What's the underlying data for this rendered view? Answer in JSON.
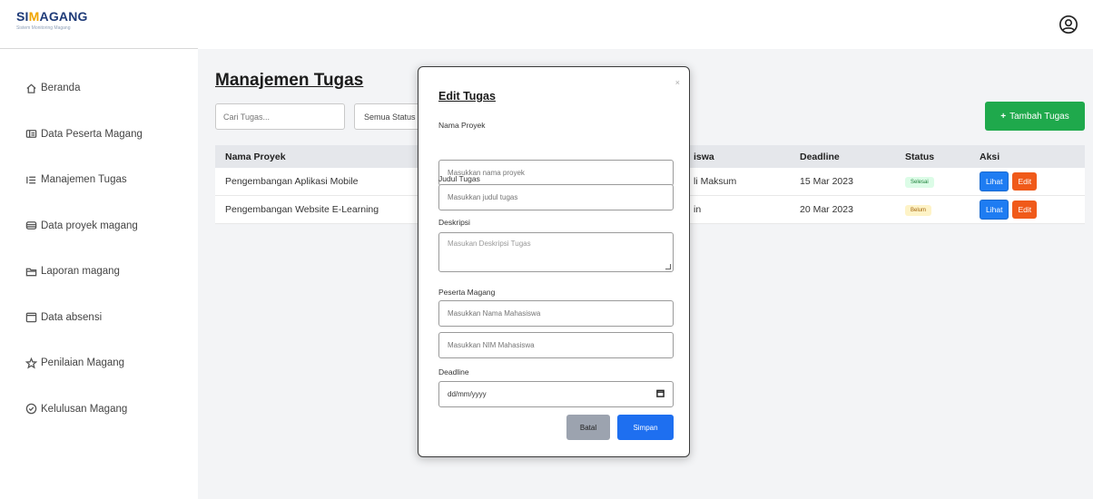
{
  "app": {
    "logo_prefix": "SI",
    "logo_accent": "M",
    "logo_suffix": "AGANG",
    "logo_subtitle": "Sistem Monitoring Magang"
  },
  "sidebar": {
    "items": [
      {
        "label": "Beranda",
        "icon": "home-icon"
      },
      {
        "label": "Data Peserta Magang",
        "icon": "id-card-icon"
      },
      {
        "label": "Manajemen Tugas",
        "icon": "list-icon"
      },
      {
        "label": "Data proyek magang",
        "icon": "database-icon"
      },
      {
        "label": "Laporan magang",
        "icon": "folder-icon"
      },
      {
        "label": "Data absensi",
        "icon": "calendar-icon"
      },
      {
        "label": "Penilaian Magang",
        "icon": "star-icon"
      },
      {
        "label": "Kelulusan Magang",
        "icon": "check-circle-icon"
      }
    ]
  },
  "topbar": {
    "profile_icon": "user-circle-icon"
  },
  "main": {
    "title": "Manajemen Tugas",
    "search_placeholder": "Cari Tugas...",
    "status_filter": "Semua Status",
    "add_button": "Tambah Tugas",
    "table": {
      "headers": [
        "Nama Proyek",
        "iswa",
        "Deadline",
        "Status",
        "Aksi"
      ],
      "rows": [
        {
          "project": "Pengembangan Aplikasi Mobile",
          "student": "li Maksum",
          "deadline": "15 Mar 2023",
          "status": "Selesai",
          "view": "Lihat",
          "edit": "Edit"
        },
        {
          "project": "Pengembangan Website E-Learning",
          "student": "in",
          "deadline": "20 Mar 2023",
          "status": "Belum",
          "view": "Lihat",
          "edit": "Edit"
        }
      ]
    }
  },
  "modal": {
    "title": "Edit Tugas",
    "close": "×",
    "project_label": "Nama Proyek",
    "project_placeholder": "Masukkan nama proyek",
    "task_label": "Judul Tugas",
    "task_placeholder": "Masukkan judul tugas",
    "desc_label": "Deskripsi",
    "desc_placeholder": "Masukan Deskripsi Tugas",
    "intern_label": "Peserta Magang",
    "student_name_placeholder": "Masukkan Nama Mahasiswa",
    "student_nim_placeholder": "Masukkan NIM Mahasiswa",
    "deadline_label": "Deadline",
    "deadline_value": "dd/mm/yyyy",
    "cancel": "Batal",
    "save": "Simpan"
  },
  "colors": {
    "primary": "#1e6ff0",
    "success": "#1fa94c",
    "danger": "#f05a1a",
    "logo_blue": "#1f3b78",
    "logo_gold": "#f0a500"
  }
}
